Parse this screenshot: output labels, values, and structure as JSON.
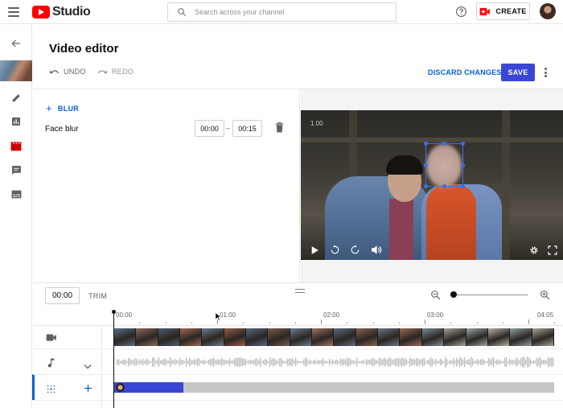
{
  "app": {
    "logo_text": "Studio",
    "search_placeholder": "Search across your channel",
    "create_label": "CREATE"
  },
  "editor": {
    "title": "Video editor",
    "undo_label": "UNDO",
    "redo_label": "REDO",
    "discard_label": "DISCARD CHANGES",
    "save_label": "SAVE"
  },
  "blur_panel": {
    "add_label": "BLUR",
    "items": [
      {
        "name": "Face blur",
        "start": "00:00",
        "end": "00:15"
      }
    ]
  },
  "preview": {
    "overlay_time": "1.00"
  },
  "timeline": {
    "current_time": "00:00",
    "trim_label": "TRIM",
    "ticks": [
      "00:00",
      "01:00",
      "02:00",
      "03:00",
      "04:05"
    ]
  },
  "colors": {
    "accent": "#065fd4",
    "save_bg": "#3a47d5",
    "brand_red": "#ff0000",
    "blur_segment": "#3a47d5"
  },
  "icons": {
    "menu": "hamburger-menu-icon",
    "search": "search-icon",
    "help": "help-circle-icon",
    "create": "video-plus-icon",
    "back": "back-arrow-icon",
    "details": "pencil-icon",
    "analytics": "analytics-icon",
    "editor": "clapperboard-icon",
    "comments": "comment-icon",
    "subtitles": "subtitles-icon"
  }
}
